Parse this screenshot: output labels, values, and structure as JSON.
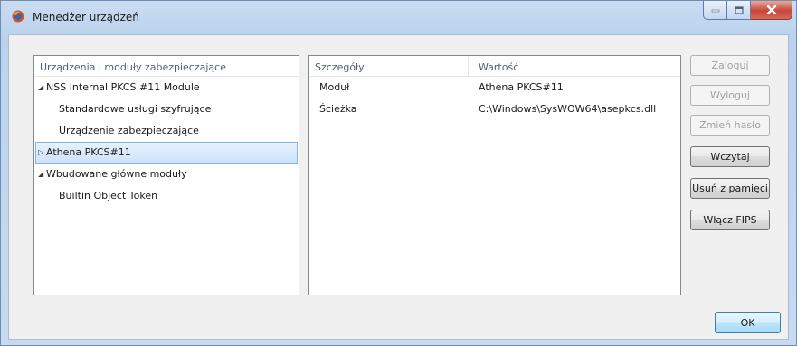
{
  "window": {
    "title": "Menedżer urządzeń",
    "icon": "firefox-icon"
  },
  "tree": {
    "header": "Urządzenia i moduły zabezpieczające",
    "items": [
      {
        "label": "NSS Internal PKCS #11 Module",
        "level": 0,
        "expanded": true,
        "selected": false
      },
      {
        "label": "Standardowe usługi szyfrujące",
        "level": 1,
        "selected": false
      },
      {
        "label": "Urządzenie zabezpieczające",
        "level": 1,
        "selected": false
      },
      {
        "label": "Athena PKCS#11",
        "level": 0,
        "expanded": false,
        "selected": true
      },
      {
        "label": "Wbudowane główne moduły",
        "level": 0,
        "expanded": true,
        "selected": false
      },
      {
        "label": "Builtin Object Token",
        "level": 1,
        "selected": false
      }
    ]
  },
  "details": {
    "header_key": "Szczegóły",
    "header_value": "Wartość",
    "rows": [
      {
        "key": "Moduł",
        "value": "Athena PKCS#11"
      },
      {
        "key": "Ścieżka",
        "value": "C:\\Windows\\SysWOW64\\asepkcs.dll"
      }
    ]
  },
  "buttons": {
    "login": {
      "label": "Zaloguj",
      "enabled": false
    },
    "logout": {
      "label": "Wyloguj",
      "enabled": false
    },
    "change_password": {
      "label": "Zmień hasło",
      "enabled": false
    },
    "load": {
      "label": "Wczytaj",
      "enabled": true
    },
    "unload": {
      "label": "Usuń z pamięci",
      "enabled": true
    },
    "enable_fips": {
      "label": "Włącz FIPS",
      "enabled": true
    },
    "ok": {
      "label": "OK",
      "enabled": true
    }
  }
}
